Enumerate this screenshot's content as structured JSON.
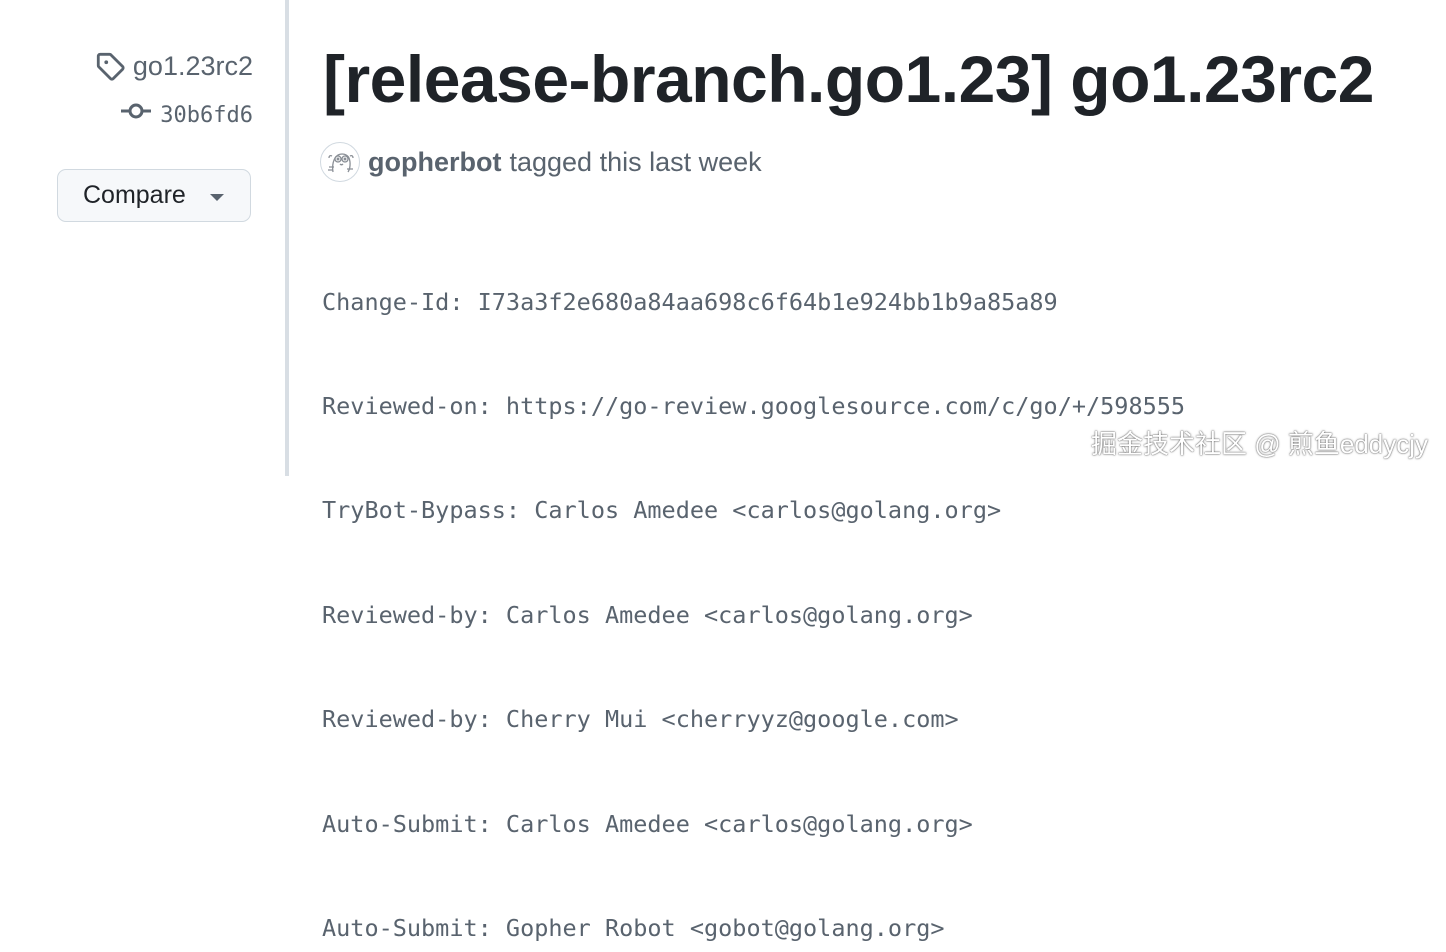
{
  "sidebar": {
    "tag": {
      "icon": "tag-icon",
      "label": "go1.23rc2"
    },
    "commit": {
      "icon": "git-commit-icon",
      "sha": "30b6fd6"
    },
    "compare_button": {
      "label": "Compare",
      "icon": "triangle-down-icon"
    }
  },
  "release": {
    "title": "[release-branch.go1.23] go1.23rc2",
    "author": {
      "name": "gopherbot",
      "avatar_icon": "gopher-avatar"
    },
    "byline_text": "tagged this last week",
    "message_lines": [
      "Change-Id: I73a3f2e680a84aa698c6f64b1e924bb1b9a85a89",
      "Reviewed-on: https://go-review.googlesource.com/c/go/+/598555",
      "TryBot-Bypass: Carlos Amedee <carlos@golang.org>",
      "Reviewed-by: Carlos Amedee <carlos@golang.org>",
      "Reviewed-by: Cherry Mui <cherryyz@google.com>",
      "Auto-Submit: Carlos Amedee <carlos@golang.org>",
      "Auto-Submit: Gopher Robot <gobot@golang.org>"
    ]
  },
  "watermark": "掘金技术社区 @ 煎鱼eddycjy",
  "colors": {
    "text_primary": "#1f2328",
    "text_muted": "#59636e",
    "border": "#d1d9e0",
    "button_bg": "#f6f8fa",
    "divider": "#d8dee4"
  }
}
